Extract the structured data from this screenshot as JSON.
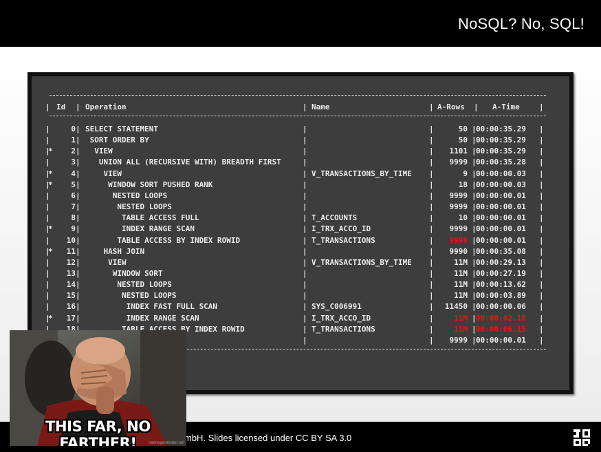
{
  "header": {
    "title": "NoSQL? No, SQL!"
  },
  "plan": {
    "headers": {
      "id": "Id",
      "operation": "Operation",
      "name": "Name",
      "arows": "A-Rows",
      "atime": "A-Time"
    },
    "rows": [
      {
        "star": "",
        "id": "0",
        "op": "SELECT STATEMENT",
        "name": "",
        "arows": "50",
        "atime": "00:00:35.29"
      },
      {
        "star": "",
        "id": "1",
        "op": " SORT ORDER BY",
        "name": "",
        "arows": "50",
        "atime": "00:00:35.29"
      },
      {
        "star": "*",
        "id": "2",
        "op": "  VIEW",
        "name": "",
        "arows": "1101",
        "atime": "00:00:35.29"
      },
      {
        "star": "",
        "id": "3",
        "op": "   UNION ALL (RECURSIVE WITH) BREADTH FIRST",
        "name": "",
        "arows": "9999",
        "atime": "00:00:35.28"
      },
      {
        "star": "*",
        "id": "4",
        "op": "    VIEW",
        "name": "V_TRANSACTIONS_BY_TIME",
        "arows": "9",
        "atime": "00:00:00.03"
      },
      {
        "star": "*",
        "id": "5",
        "op": "     WINDOW SORT PUSHED RANK",
        "name": "",
        "arows": "18",
        "atime": "00:00:00.03"
      },
      {
        "star": "",
        "id": "6",
        "op": "      NESTED LOOPS",
        "name": "",
        "arows": "9999",
        "atime": "00:00:00.01"
      },
      {
        "star": "",
        "id": "7",
        "op": "       NESTED LOOPS",
        "name": "",
        "arows": "9999",
        "atime": "00:00:00.01"
      },
      {
        "star": "",
        "id": "8",
        "op": "        TABLE ACCESS FULL",
        "name": "T_ACCOUNTS",
        "arows": "10",
        "atime": "00:00:00.01"
      },
      {
        "star": "*",
        "id": "9",
        "op": "        INDEX RANGE SCAN",
        "name": "I_TRX_ACCO_ID",
        "arows": "9999",
        "atime": "00:00:00.01"
      },
      {
        "star": "",
        "id": "10",
        "op": "       TABLE ACCESS BY INDEX ROWID",
        "name": "T_TRANSACTIONS",
        "arows": "9999",
        "atime": "00:00:00.01"
      },
      {
        "star": "*",
        "id": "11",
        "op": "    HASH JOIN",
        "name": "",
        "arows": "9990",
        "atime": "00:00:35.08"
      },
      {
        "star": "",
        "id": "12",
        "op": "     VIEW",
        "name": "V_TRANSACTIONS_BY_TIME",
        "arows": "11M",
        "atime": "00:00:29.13"
      },
      {
        "star": "",
        "id": "13",
        "op": "      WINDOW SORT",
        "name": "",
        "arows": "11M",
        "atime": "00:00:27.19"
      },
      {
        "star": "",
        "id": "14",
        "op": "       NESTED LOOPS",
        "name": "",
        "arows": "11M",
        "atime": "00:00:13.62"
      },
      {
        "star": "",
        "id": "15",
        "op": "        NESTED LOOPS",
        "name": "",
        "arows": "11M",
        "atime": "00:00:03.89"
      },
      {
        "star": "",
        "id": "16",
        "op": "         INDEX FAST FULL SCAN",
        "name": "SYS_C006991",
        "arows": "11450",
        "atime": "00:00:00.06"
      },
      {
        "star": "*",
        "id": "17",
        "op": "         INDEX RANGE SCAN",
        "name": "I_TRX_ACCO_ID",
        "arows": "11M",
        "atime": "00:00:02.18"
      },
      {
        "star": "",
        "id": "18",
        "op": "        TABLE ACCESS BY INDEX ROWID",
        "name": "T_TRANSACTIONS",
        "arows": "11M",
        "atime": "00:00:06.15"
      },
      {
        "star": "",
        "id": "",
        "op": "                PUMP",
        "name": "",
        "arows": "9999",
        "atime": "00:00:00.01"
      }
    ],
    "highlight_color": "#e11111"
  },
  "meme": {
    "caption": "THIS FAR, NO FARTHER!",
    "watermark": "memegenerator.net"
  },
  "footer": {
    "license": "mbH. Slides licensed under CC BY SA 3.0",
    "logo_icon": "jooq-logo-icon"
  }
}
